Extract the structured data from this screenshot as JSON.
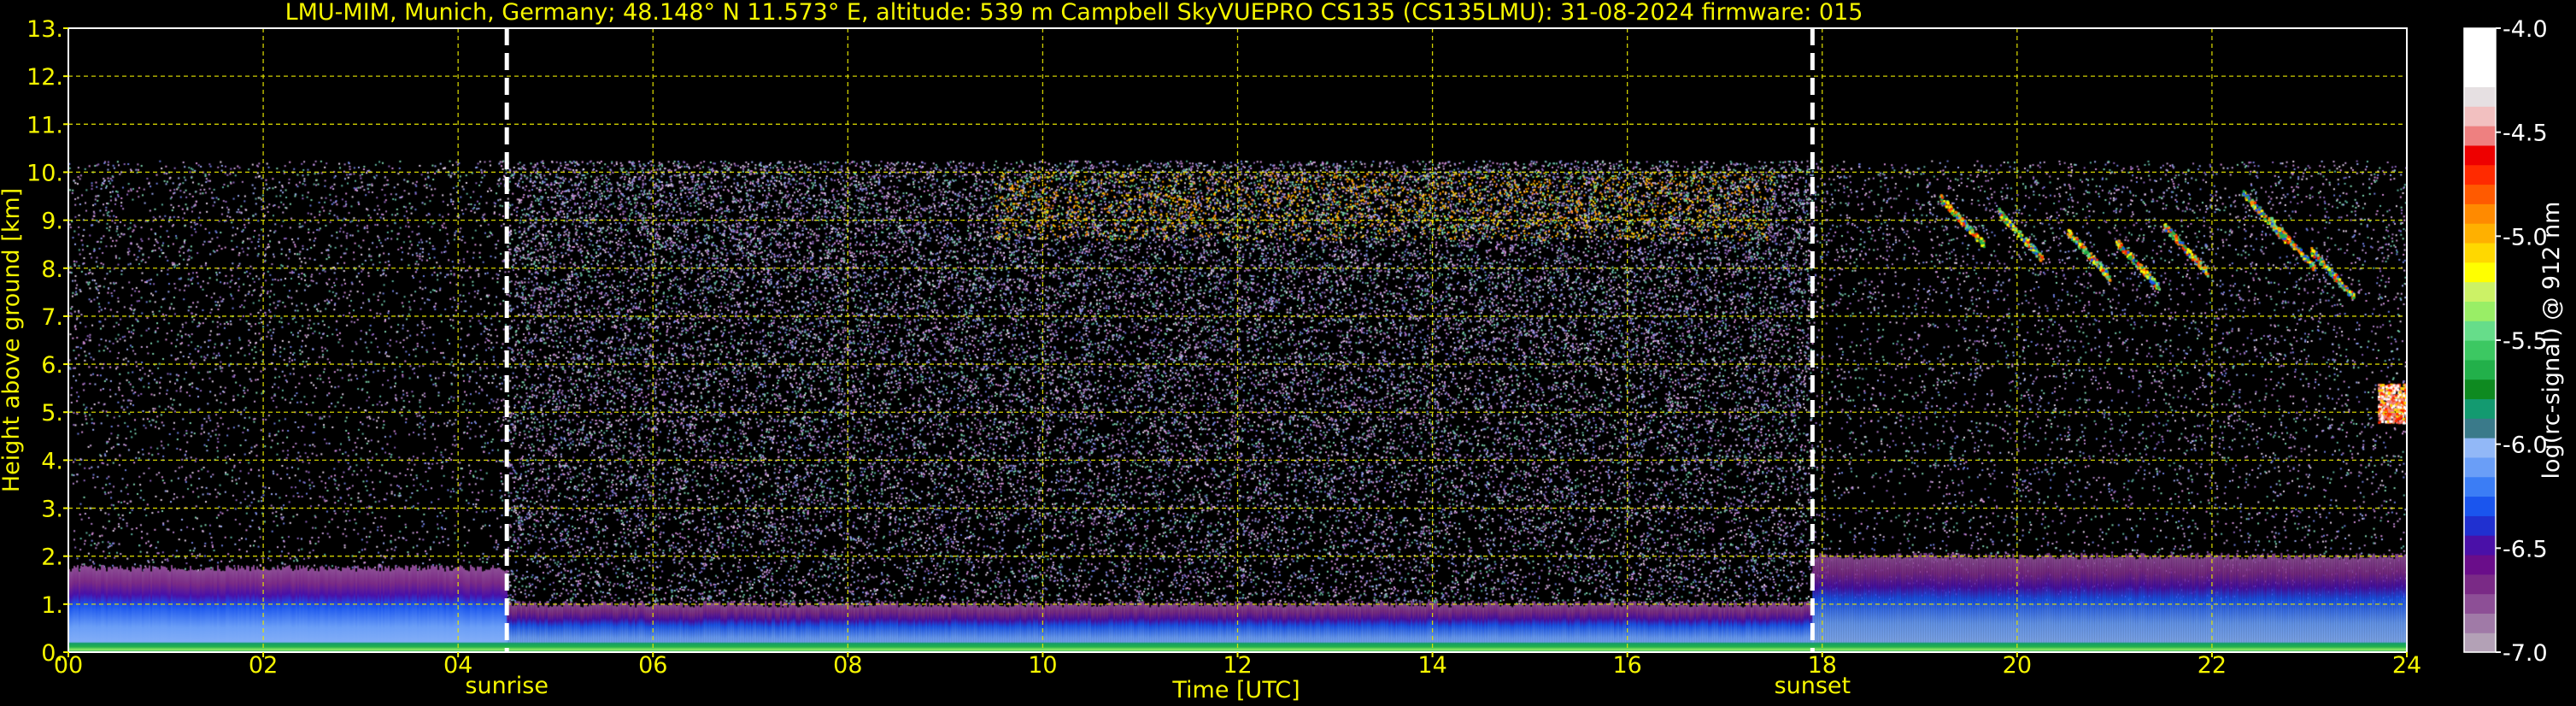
{
  "chart_data": {
    "type": "heatmap",
    "title": "LMU-MIM, Munich, Germany; 48.148° N 11.573° E, altitude: 539 m    Campbell SkyVUEPRO CS135 (CS135LMU): 31-08-2024    firmware: 015",
    "xlabel": "Time [UTC]",
    "ylabel": "Height above ground [km]",
    "xlim": [
      0,
      24
    ],
    "ylim": [
      0,
      13
    ],
    "x_ticks": [
      0,
      2,
      4,
      6,
      8,
      10,
      12,
      14,
      16,
      18,
      20,
      22,
      24
    ],
    "x_tick_labels": [
      "00",
      "02",
      "04",
      "06",
      "08",
      "10",
      "12",
      "14",
      "16",
      "18",
      "20",
      "22",
      "24"
    ],
    "y_ticks": [
      0,
      1,
      2,
      3,
      4,
      5,
      6,
      7,
      8,
      9,
      10,
      11,
      12,
      13
    ],
    "y_tick_labels": [
      "0.",
      "1.",
      "2.",
      "3.",
      "4.",
      "5.",
      "6.",
      "7.",
      "8.",
      "9.",
      "10.",
      "11.",
      "12.",
      "13."
    ],
    "grid": true,
    "grid_color": "#e6e600",
    "axis_text_color": "#f5f500",
    "background_color": "#000000",
    "data_max_height_km": 10.25,
    "markers": [
      {
        "label": "sunrise",
        "time": 4.5
      },
      {
        "label": "sunset",
        "time": 17.9
      }
    ],
    "colorbar": {
      "label": "log(rc-signal) @ 912 nm",
      "range": [
        -7.0,
        -4.0
      ],
      "ticks": [
        -7.0,
        -6.5,
        -6.0,
        -5.5,
        -5.0,
        -4.5,
        -4.0
      ],
      "tick_labels": [
        "-7.0",
        "-6.5",
        "-6.0",
        "-5.5",
        "-5.0",
        "-4.5",
        "-4.0"
      ],
      "colors": [
        "#b3a1b6",
        "#a07aa7",
        "#8d4f96",
        "#7a2a86",
        "#6a0d8a",
        "#4a10a8",
        "#2030d0",
        "#1a55ee",
        "#3b7df5",
        "#6a9ef7",
        "#92b8f7",
        "#3a7a8a",
        "#139a70",
        "#0e8a20",
        "#22b04a",
        "#3cc862",
        "#66dd8a",
        "#99ee66",
        "#ccf266",
        "#ffff00",
        "#ffd800",
        "#ffb000",
        "#ff8a00",
        "#ff5a00",
        "#ff2a00",
        "#ee0000",
        "#ee8080",
        "#f2c0c0",
        "#e6e0e2",
        "#ffffff",
        "#ffffff",
        "#ffffff"
      ]
    },
    "regions": [
      {
        "feature": "boundary layer",
        "time": [
          0,
          4.5
        ],
        "height_km": [
          0,
          1.75
        ],
        "level": -6.3
      },
      {
        "feature": "boundary layer",
        "time": [
          4.5,
          17.9
        ],
        "height_km": [
          0,
          1.0
        ],
        "level": -6.2
      },
      {
        "feature": "boundary layer",
        "time": [
          17.9,
          24
        ],
        "height_km": [
          0,
          2.0
        ],
        "level": -6.1
      },
      {
        "feature": "surface layer",
        "time": [
          0,
          24
        ],
        "height_km": [
          0,
          0.2
        ],
        "level": -5.7
      },
      {
        "feature": "cirrus",
        "time": [
          18.6,
          23.5
        ],
        "height_km": [
          7.8,
          10.2
        ],
        "level": -5.2
      },
      {
        "feature": "cloud",
        "time": [
          23.7,
          24
        ],
        "height_km": [
          4.8,
          5.6
        ],
        "level": -4.3
      },
      {
        "feature": "noise",
        "time": [
          0,
          24
        ],
        "height_km": [
          1.0,
          10.25
        ],
        "level": -6.5
      }
    ]
  }
}
